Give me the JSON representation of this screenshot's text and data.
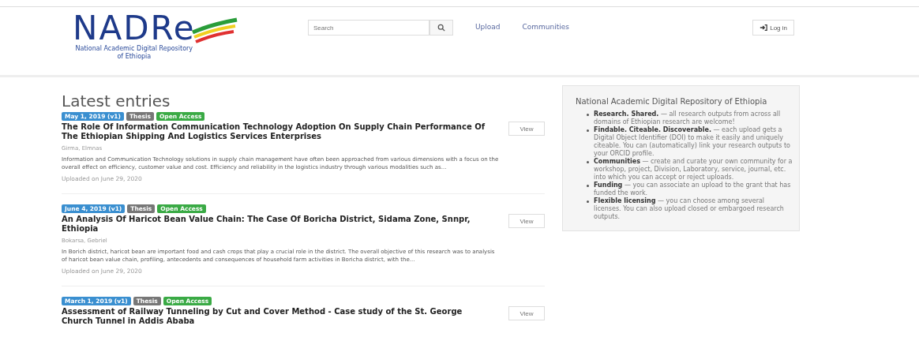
{
  "header": {
    "logo": {
      "wordmark": "NADRe",
      "subtitle": "National Academic Digital Repository of Ethiopia"
    },
    "search": {
      "placeholder": "Search"
    },
    "nav": [
      "Upload",
      "Communities"
    ],
    "login": "Log in"
  },
  "latest": {
    "heading": "Latest entries",
    "entries": [
      {
        "badges": [
          {
            "kind": "date",
            "text": "May 1, 2019 (v1)"
          },
          {
            "kind": "type",
            "text": "Thesis"
          },
          {
            "kind": "access",
            "text": "Open Access"
          }
        ],
        "title": "The Role Of Information Communication Technology Adoption On Supply Chain Performance Of The Ethiopian Shipping And Logistics Services Enterprises",
        "authors": "Girma, Elmnas",
        "abstract": "Information and Communication Technology solutions in supply chain management have often been approached from various dimensions with a focus on the overall effect on efficiency, customer value and cost. Efficiency and reliability in the logistics industry through various modalities such as...",
        "uploaded": "Uploaded on June 29, 2020",
        "view": "View"
      },
      {
        "badges": [
          {
            "kind": "date",
            "text": "June 4, 2019 (v1)"
          },
          {
            "kind": "type",
            "text": "Thesis"
          },
          {
            "kind": "access",
            "text": "Open Access"
          }
        ],
        "title": "An Analysis Of Haricot Bean Value Chain: The Case Of Boricha District, Sidama Zone, Snnpr, Ethiopia",
        "authors": "Bokarsa, Gebriel",
        "abstract": "In Borich district, haricot bean are important food and cash crops that play a crucial role in the district. The overall objective of this research was to analysis of haricot bean value chain, profiling, antecedents and consequences of household farm activities in Boricha district, with the...",
        "uploaded": "Uploaded on June 29, 2020",
        "view": "View"
      },
      {
        "badges": [
          {
            "kind": "date",
            "text": "March 1, 2019 (v1)"
          },
          {
            "kind": "type",
            "text": "Thesis"
          },
          {
            "kind": "access",
            "text": "Open Access"
          }
        ],
        "title": "Assessment of Railway Tunneling by Cut and Cover Method - Case study of the St. George Church Tunnel in Addis Ababa",
        "view": "View"
      }
    ]
  },
  "sidebar": {
    "title": "National Academic Digital Repository of Ethiopia",
    "items": [
      "**Research. Shared.** — all research outputs from across all domains of Ethiopian research are welcome!",
      "**Findable. Citeable. Discoverable.** — each upload gets a Digital Object Identifier (DOI) to make it easily and uniquely citeable. You can (automatically) link your research outputs to your ORCID profile.",
      "**Communities** — create and curate your own community for a workshop, project, Division, Laboratory, service, journal, etc. into which you can accept or reject uploads.",
      "**Funding** — you can associate an upload to the grant that has funded the work.",
      "**Flexible licensing** — you can choose among several licenses. You can also upload closed or embargoed research outputs."
    ]
  }
}
